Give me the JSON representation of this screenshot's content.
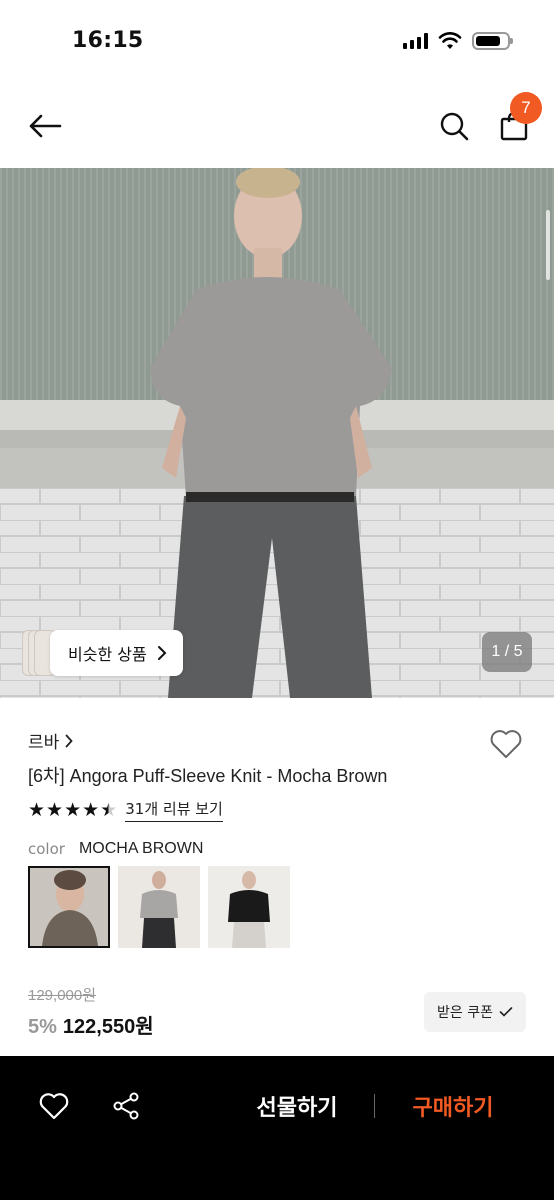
{
  "status_bar": {
    "time": "16:15"
  },
  "nav": {
    "cart_count": "7"
  },
  "gallery": {
    "similar_label": "비슷한 상품",
    "counter": "1 / 5"
  },
  "product": {
    "brand": "르바",
    "title": "[6차] Angora Puff-Sleeve Knit - Mocha Brown",
    "rating": 4.5,
    "review_link": "31개 리뷰 보기",
    "color_label": "color",
    "color_value": "MOCHA BROWN",
    "swatches": [
      "mocha-brown",
      "gray",
      "black"
    ],
    "original_price": "129,000원",
    "discount": "5%",
    "sale_price": "122,550원",
    "coupon_label": "받은 쿠폰"
  },
  "bottom_bar": {
    "gift_label": "선물하기",
    "buy_label": "구매하기",
    "accent_color": "#f15a22"
  }
}
